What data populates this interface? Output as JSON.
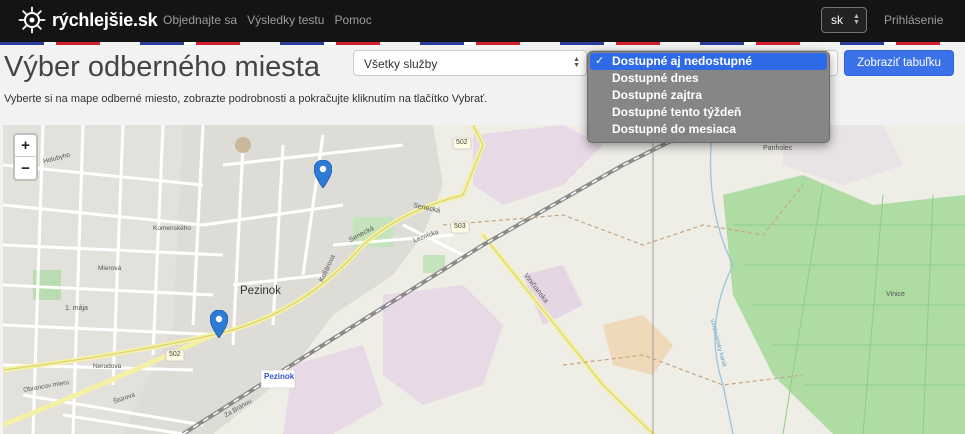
{
  "nav": {
    "brand": "rýchlejšie.sk",
    "links": [
      "Objednajte sa",
      "Výsledky testu",
      "Pomoc"
    ],
    "lang": "sk",
    "login": "Prihlásenie"
  },
  "page": {
    "title": "Výber odberného miesta",
    "subtitle": "Vyberte si na mape odberné miesto, zobrazte podrobnosti a pokračujte kliknutím na tlačítko Vybrať."
  },
  "filters": {
    "service_select": "Všetky služby",
    "availability_options": [
      "Dostupné aj nedostupné",
      "Dostupné dnes",
      "Dostupné zajtra",
      "Dostupné tento týždeň",
      "Dostupné do mesiaca"
    ],
    "selected_index": 0,
    "show_table_button": "Zobraziť tabuľku"
  },
  "map": {
    "zoom_in": "+",
    "zoom_out": "−",
    "labels": {
      "town": "Pezinok",
      "town_poi": "Pezinok",
      "street_senecka": "Senecká",
      "street_senecka2": "Senecká",
      "road_502a": "502",
      "road_502b": "502",
      "road_503": "503",
      "vinicna": "Viničianska",
      "kollarova": "Kollárova",
      "panholec": "Panholec",
      "vinice": "Vinice",
      "kanal": "Viničniansky kanál",
      "jesenskeho": "1. mája",
      "leznicka": "Leznícka",
      "stefanikova": "Za Bránou",
      "holubyho": "Holubyho",
      "mierova": "Mierová",
      "komenskeho": "Komenského",
      "obranicov": "Obrancov mieru",
      "nerudova": "Nerudova",
      "sturova": "Štúrova"
    }
  },
  "colors": {
    "nav_bg": "#141414",
    "primary": "#3b72ea",
    "dropdown_selected": "#2f6ae8",
    "marker": "#2e7bd6"
  }
}
